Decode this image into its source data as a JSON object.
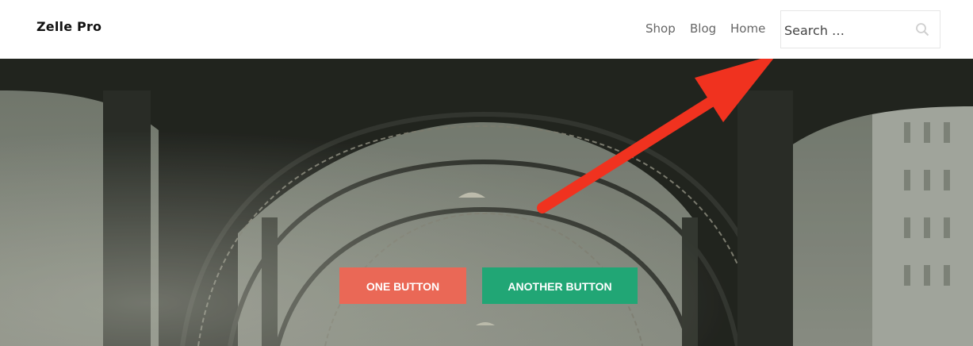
{
  "header": {
    "site_title": "Zelle Pro",
    "nav": [
      "Shop",
      "Blog",
      "Home"
    ],
    "search_placeholder": "Search …"
  },
  "hero": {
    "button_one": "ONE BUTTON",
    "button_two": "ANOTHER BUTTON"
  },
  "colors": {
    "button_one": "#ea6856",
    "button_two": "#21a675",
    "annotation_arrow": "#f0321f"
  }
}
